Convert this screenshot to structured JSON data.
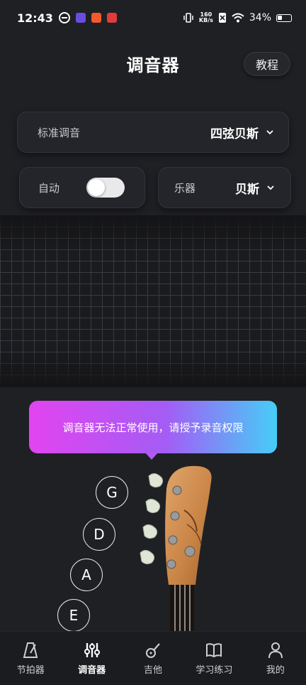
{
  "status_bar": {
    "time": "12:43",
    "net_speed_value": "160",
    "net_speed_unit": "KB/s",
    "battery": "34%"
  },
  "header": {
    "title": "调音器",
    "tutorial_label": "教程"
  },
  "tuning": {
    "label": "标准调音",
    "value": "四弦贝斯"
  },
  "auto": {
    "label": "自动",
    "enabled": false
  },
  "instrument": {
    "label": "乐器",
    "value": "贝斯"
  },
  "permission_banner": "调音器无法正常使用，请授予录音权限",
  "strings": [
    "G",
    "D",
    "A",
    "E"
  ],
  "nav": {
    "items": [
      {
        "label": "节拍器",
        "icon": "metronome-icon"
      },
      {
        "label": "调音器",
        "icon": "tuner-sliders-icon",
        "active": true
      },
      {
        "label": "吉他",
        "icon": "guitar-icon"
      },
      {
        "label": "学习练习",
        "icon": "book-icon"
      },
      {
        "label": "我的",
        "icon": "person-icon"
      }
    ]
  },
  "colors": {
    "background": "#1f2024",
    "banner_start": "#e244f0",
    "banner_end": "#46cdf7",
    "highlight": "#e0202a"
  }
}
